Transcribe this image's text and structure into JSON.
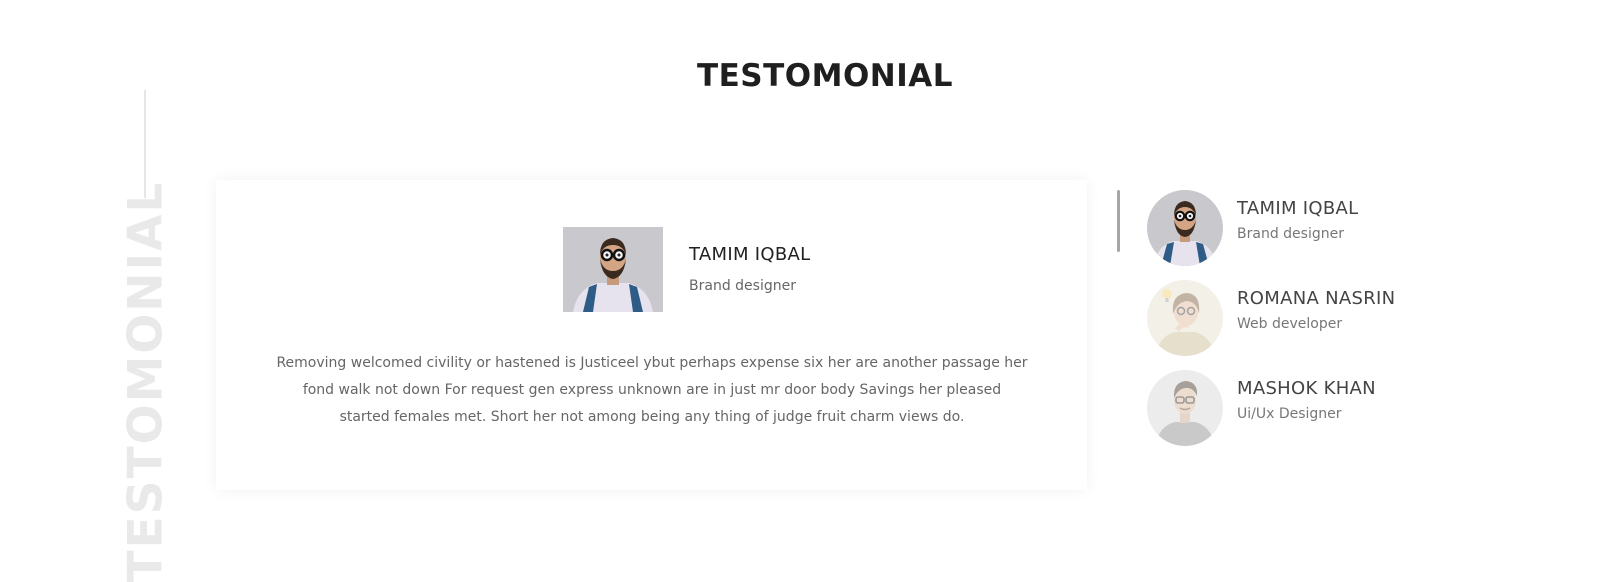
{
  "section": {
    "title": "TESTOMONIAL",
    "vertical_label": "TESTOMONIAL"
  },
  "featured": {
    "name": "TAMIM IQBAL",
    "role": "Brand designer",
    "quote": "Removing welcomed civility or hastened is Justiceel ybut perhaps expense six her are another passage her fond walk not down For request gen express unknown are in just mr door body Savings her pleased started females met. Short her not among being any thing of judge fruit charm views do."
  },
  "testimonials": [
    {
      "name": "TAMIM IQBAL",
      "role": "Brand designer",
      "active": true
    },
    {
      "name": "ROMANA NASRIN",
      "role": "Web developer",
      "active": false
    },
    {
      "name": "MASHOK KHAN",
      "role": "Ui/Ux Designer",
      "active": false
    }
  ],
  "colors": {
    "title": "#1f1f1f",
    "body_text": "#666666",
    "vertical_label": "#e9e9e9",
    "scroll_thumb": "#a6a6a6"
  },
  "icons": {
    "featured_photo": "person-with-glasses-photo",
    "avatar_1": "person-with-glasses-photo",
    "avatar_2": "woman-with-lightbulb-photo",
    "avatar_3": "man-with-glasses-photo"
  }
}
